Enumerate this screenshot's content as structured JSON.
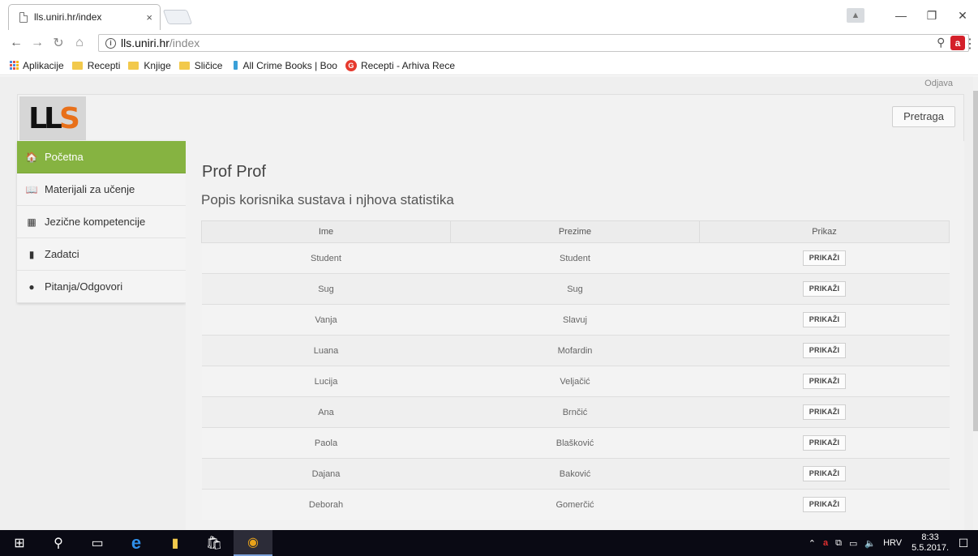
{
  "browser": {
    "tab_title": "lls.uniri.hr/index",
    "tab_close": "×",
    "url_host": "lls.uniri.hr",
    "url_path": "/index",
    "window_controls": {
      "minimize": "—",
      "restore": "❐",
      "close": "✕"
    },
    "bookmarks": [
      {
        "label": "Aplikacije",
        "icon": "apps-grid-icon"
      },
      {
        "label": "Recepti",
        "icon": "folder-icon"
      },
      {
        "label": "Knjige",
        "icon": "folder-icon"
      },
      {
        "label": "Sličice",
        "icon": "folder-icon"
      },
      {
        "label": "All Crime Books | Boo",
        "icon": "book-icon"
      },
      {
        "label": "Recepti - Arhiva Rece",
        "icon": "recipe-site-icon"
      }
    ]
  },
  "page": {
    "logout_label": "Odjava",
    "logo_text": "LLS",
    "search_button_label": "Pretraga",
    "sidebar": [
      {
        "label": "Početna",
        "icon": "home-icon",
        "active": true
      },
      {
        "label": "Materijali za učenje",
        "icon": "book-icon",
        "active": false
      },
      {
        "label": "Jezične kompetencije",
        "icon": "calendar-icon",
        "active": false
      },
      {
        "label": "Zadatci",
        "icon": "clipboard-icon",
        "active": false
      },
      {
        "label": "Pitanja/Odgovori",
        "icon": "speech-bubble-icon",
        "active": false
      }
    ],
    "title": "Prof Prof",
    "subtitle": "Popis korisnika sustava i njhova statistika",
    "table": {
      "columns": [
        "Ime",
        "Prezime",
        "Prikaz"
      ],
      "button_label": "PRIKAŽI",
      "rows": [
        {
          "ime": "Student",
          "prezime": "Student"
        },
        {
          "ime": "Sug",
          "prezime": "Sug"
        },
        {
          "ime": "Vanja",
          "prezime": "Slavuj"
        },
        {
          "ime": "Luana",
          "prezime": "Mofardin"
        },
        {
          "ime": "Lucija",
          "prezime": "Veljačić"
        },
        {
          "ime": "Ana",
          "prezime": "Brnčić"
        },
        {
          "ime": "Paola",
          "prezime": "Blašković"
        },
        {
          "ime": "Dajana",
          "prezime": "Baković"
        },
        {
          "ime": "Deborah",
          "prezime": "Gomerčić"
        }
      ]
    }
  },
  "taskbar": {
    "language": "HRV",
    "time": "8:33",
    "date": "5.5.2017."
  },
  "colors": {
    "active_nav": "#86b341",
    "logo_accent": "#e8701a",
    "taskbar": "#0a0a14"
  }
}
